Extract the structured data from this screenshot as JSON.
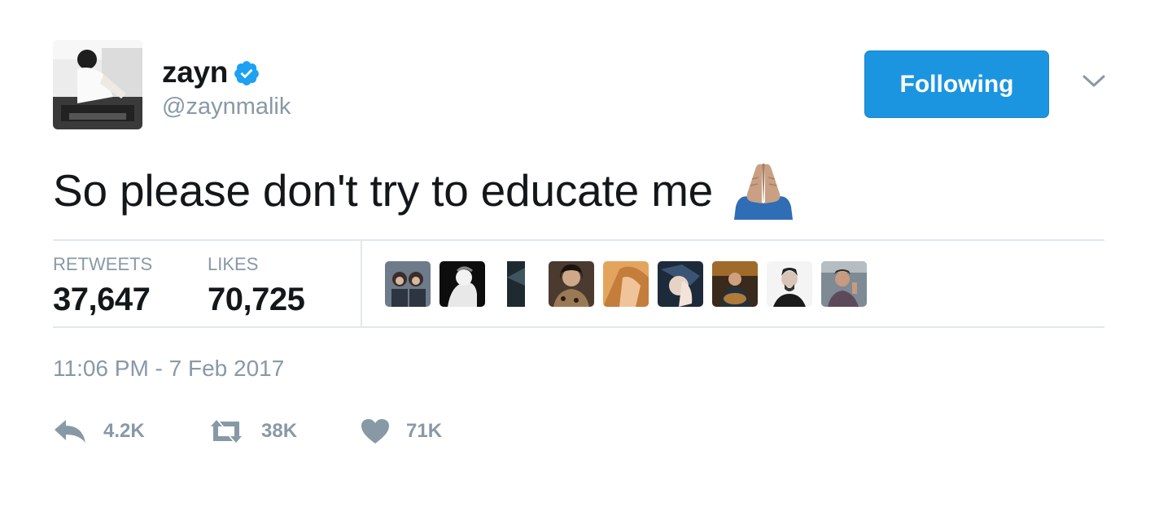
{
  "user": {
    "display_name": "zayn",
    "handle": "@zaynmalik",
    "verified": true
  },
  "follow_button": {
    "label": "Following",
    "color": "#1b95e0"
  },
  "tweet": {
    "text": "So please don't try to educate me",
    "emoji": "folded-hands-medium-skin-tone"
  },
  "stats": {
    "retweets_label": "RETWEETS",
    "retweets_value": "37,647",
    "likes_label": "LIKES",
    "likes_value": "70,725"
  },
  "likers": [
    {
      "icon": "liker-avatar-1"
    },
    {
      "icon": "liker-avatar-2"
    },
    {
      "icon": "liker-avatar-3"
    },
    {
      "icon": "liker-avatar-4"
    },
    {
      "icon": "liker-avatar-5"
    },
    {
      "icon": "liker-avatar-6"
    },
    {
      "icon": "liker-avatar-7"
    },
    {
      "icon": "liker-avatar-8"
    },
    {
      "icon": "liker-avatar-9"
    }
  ],
  "timestamp": "11:06 PM - 7 Feb 2017",
  "actions": {
    "reply_count": "4.2K",
    "retweet_count": "38K",
    "like_count": "71K"
  },
  "colors": {
    "muted": "#8899a6",
    "text": "#14171a",
    "divider": "#e1e8ed",
    "accent": "#1b95e0"
  }
}
